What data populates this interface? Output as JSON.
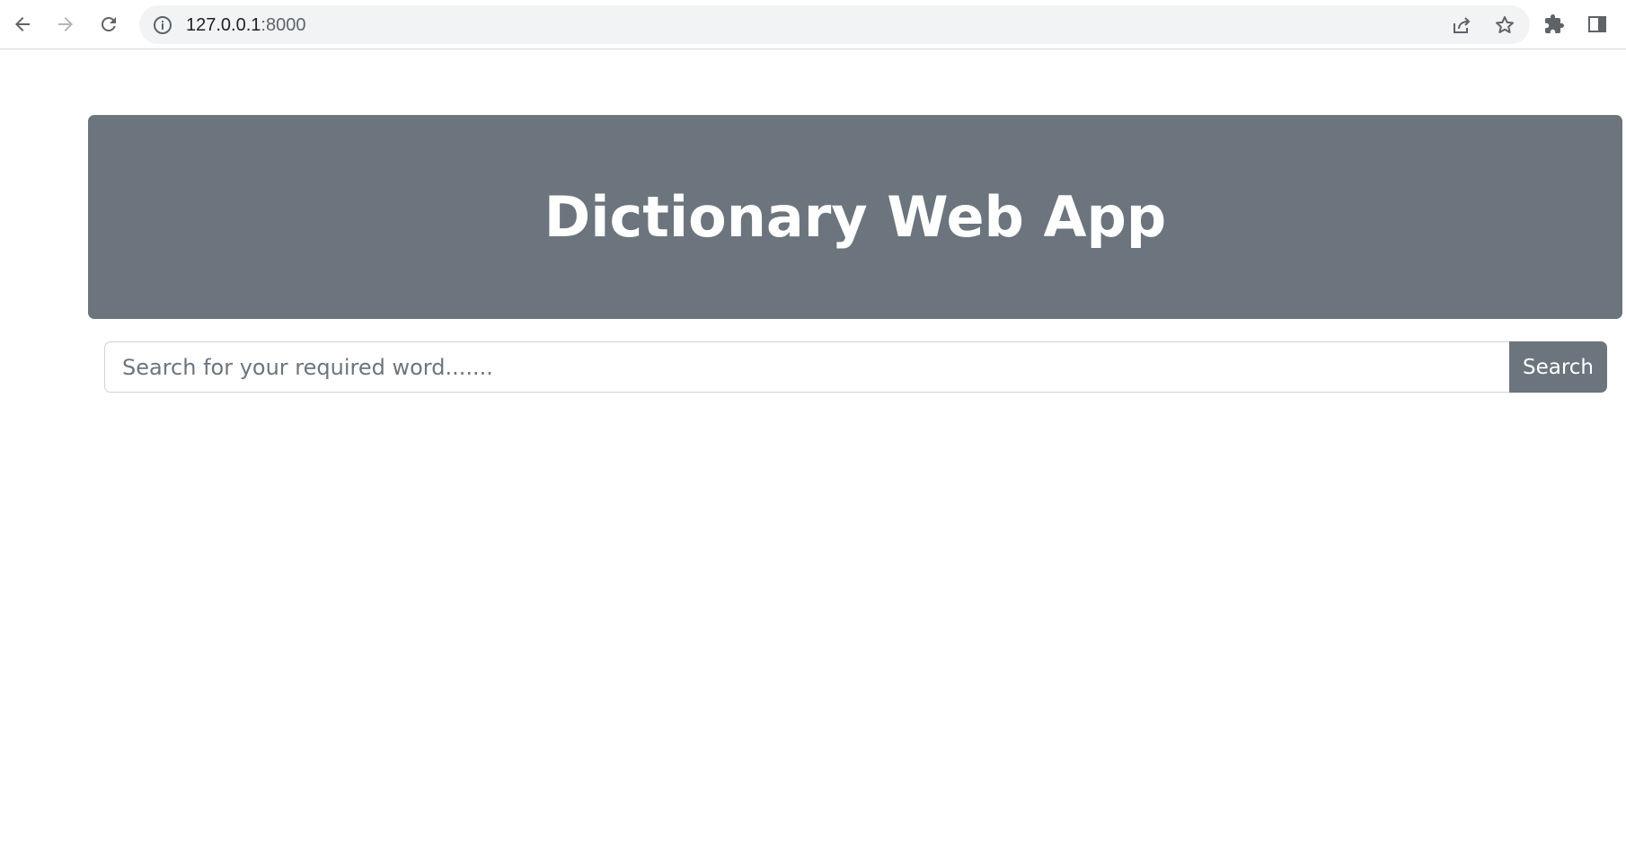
{
  "browser": {
    "url_host": "127.0.0.1",
    "url_port": ":8000",
    "icons": {
      "back": "back-arrow-icon",
      "forward": "forward-arrow-icon",
      "reload": "reload-icon",
      "info": "info-icon",
      "share": "share-icon",
      "bookmark": "star-icon",
      "extensions": "puzzle-icon",
      "side_panel": "side-panel-icon"
    }
  },
  "app": {
    "title": "Dictionary Web App",
    "search": {
      "placeholder": "Search for your required word.......",
      "value": "",
      "button_label": "Search"
    },
    "colors": {
      "banner": "#6c757d",
      "button": "#6c757d"
    }
  }
}
